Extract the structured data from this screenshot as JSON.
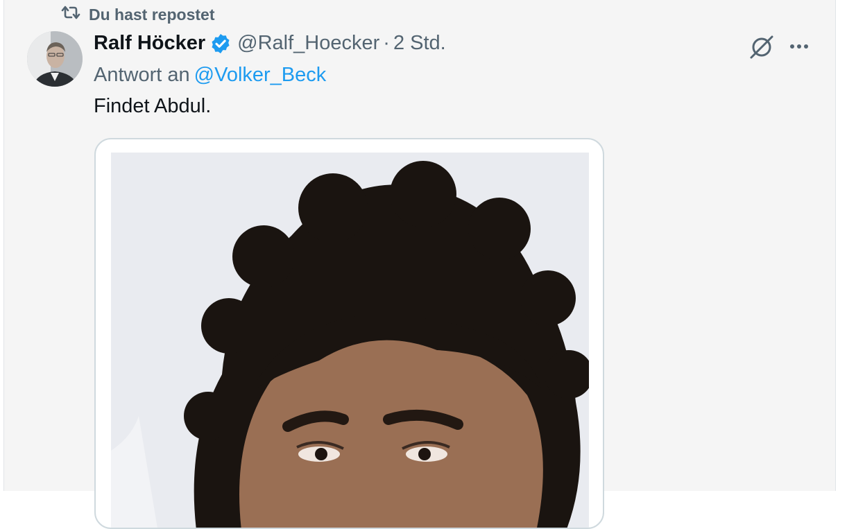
{
  "repost": {
    "label": "Du hast repostet",
    "icon": "repost-icon"
  },
  "tweet": {
    "author_name": "Ralf Höcker",
    "author_handle": "@Ralf_Hoecker",
    "separator": "·",
    "timestamp": "2 Std.",
    "reply_prefix": "Antwort an",
    "reply_to": "@Volker_Beck",
    "text": "Findet Abdul."
  },
  "icons": {
    "verified": "verified-badge-icon",
    "grok": "grok-icon",
    "more": "more-icon"
  },
  "colors": {
    "accent": "#1d9bf0",
    "secondary_text": "#536471",
    "primary_text": "#0f1419",
    "background": "#f5f5f5"
  }
}
